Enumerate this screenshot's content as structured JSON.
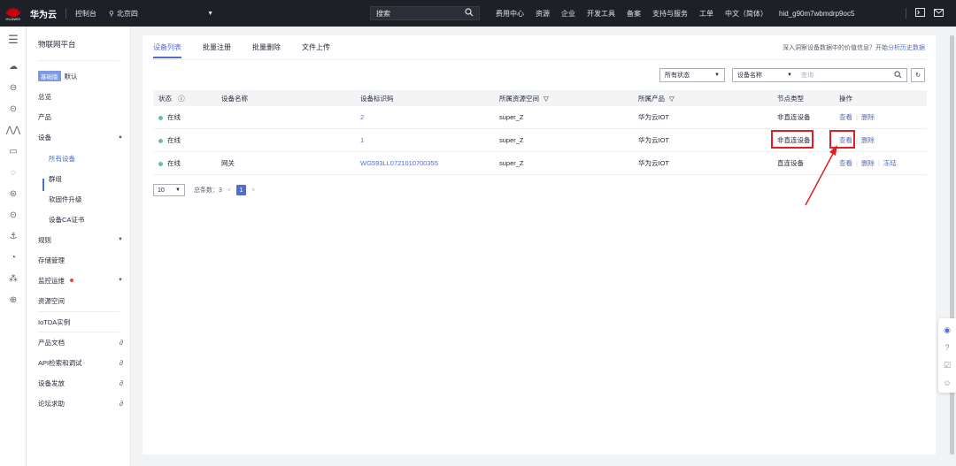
{
  "topbar": {
    "logo_text": "HUAWEI",
    "brand": "华为云",
    "console": "控制台",
    "region": "北京四",
    "search_placeholder": "搜索",
    "nav": [
      "费用中心",
      "资源",
      "企业",
      "开发工具",
      "备案",
      "支持与服务",
      "工单",
      "中文（简体）",
      "hid_g90m7wbmdrp9oc5"
    ],
    "accent_bg": "#1e2028"
  },
  "sidebar": {
    "title": "物联网平台",
    "edition_badge": "基础版",
    "instance": "默认",
    "items": {
      "overview": "总览",
      "products": "产品",
      "devices": "设备",
      "all_devices": "所有设备",
      "groups": "群组",
      "firmware": "软固件升级",
      "ca_cert": "设备CA证书",
      "rules": "规则",
      "storage": "存储管理",
      "monitoring": "监控运维",
      "resource_space": "资源空间",
      "iotda_instance": "IoTDA实例",
      "product_docs": "产品文档",
      "api_debug": "API检索和调试",
      "provisioning": "设备发放",
      "forum": "论坛求助"
    }
  },
  "tabs": [
    "设备列表",
    "批量注册",
    "批量删除",
    "文件上传"
  ],
  "tip": {
    "text": "深入洞察设备数据中的价值信息？开始",
    "link": "分析历史数据"
  },
  "filters": {
    "status": "所有状态",
    "field": "设备名称",
    "query_placeholder": "查询"
  },
  "table": {
    "headers": [
      "状态",
      "设备名称",
      "设备标识码",
      "所属资源空间",
      "所属产品",
      "节点类型",
      "操作"
    ],
    "rows": [
      {
        "status": "在线",
        "name": "",
        "id": "2",
        "space": "super_Z",
        "product": "华为云IOT",
        "node": "非直连设备",
        "ops": [
          "查看",
          "删除"
        ]
      },
      {
        "status": "在线",
        "name": "",
        "id": "1",
        "space": "super_Z",
        "product": "华为云IOT",
        "node": "非直连设备",
        "ops": [
          "查看",
          "删除"
        ]
      },
      {
        "status": "在线",
        "name": "网关",
        "id": "WG593LL0721010700355",
        "space": "super_Z",
        "product": "华为云IOT",
        "node": "直连设备",
        "ops": [
          "查看",
          "删除",
          "冻结"
        ]
      }
    ]
  },
  "pagination": {
    "page_size": "10",
    "total": "总条数：3",
    "current": "1"
  },
  "colors": {
    "primary": "#526ecc",
    "online": "#5fc3a0",
    "highlight": "#e02020"
  }
}
